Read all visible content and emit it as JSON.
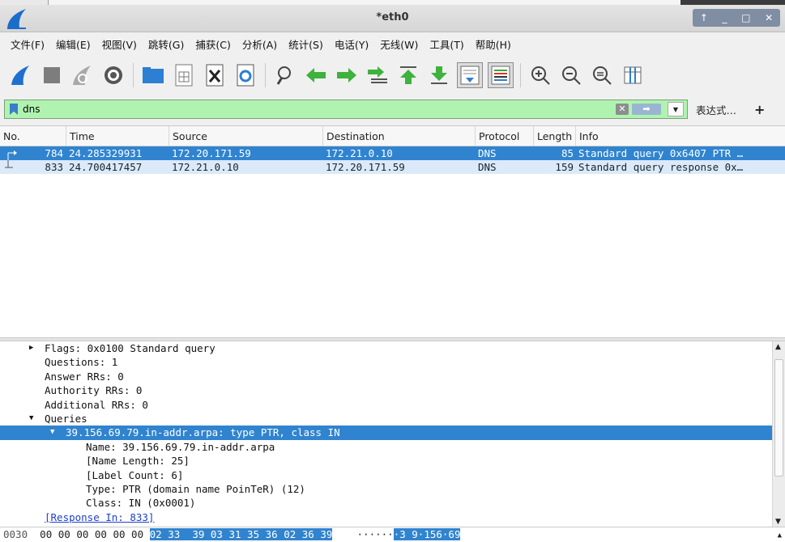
{
  "window": {
    "title": "*eth0",
    "controls": [
      "↑",
      "_",
      "□",
      "✕"
    ]
  },
  "menu": [
    "文件(F)",
    "编辑(E)",
    "视图(V)",
    "跳转(G)",
    "捕获(C)",
    "分析(A)",
    "统计(S)",
    "电话(Y)",
    "无线(W)",
    "工具(T)",
    "帮助(H)"
  ],
  "filter": {
    "value": "dns",
    "expression_label": "表达式…",
    "add_label": "+",
    "bg_color": "#b0f3b0"
  },
  "packet_list": {
    "columns": [
      "No.",
      "Time",
      "Source",
      "Destination",
      "Protocol",
      "Length",
      "Info"
    ],
    "rows": [
      {
        "no": "784",
        "time": "24.285329931",
        "src": "172.20.171.59",
        "dst": "172.21.0.10",
        "proto": "DNS",
        "len": "85",
        "info": "Standard query 0x6407 PTR …"
      },
      {
        "no": "833",
        "time": "24.700417457",
        "src": "172.21.0.10",
        "dst": "172.20.171.59",
        "proto": "DNS",
        "len": "159",
        "info": "Standard query response 0x…"
      }
    ]
  },
  "details": [
    {
      "text": "Flags: 0x0100 Standard query",
      "arrow": "▶"
    },
    {
      "text": "Questions: 1"
    },
    {
      "text": "Answer RRs: 0"
    },
    {
      "text": "Authority RRs: 0"
    },
    {
      "text": "Additional RRs: 0"
    },
    {
      "text": "Queries",
      "arrow": "▼"
    },
    {
      "text": "39.156.69.79.in-addr.arpa: type PTR, class IN",
      "arrow": "▼"
    },
    {
      "text": "Name: 39.156.69.79.in-addr.arpa"
    },
    {
      "text": "[Name Length: 25]"
    },
    {
      "text": "[Label Count: 6]"
    },
    {
      "text": "Type: PTR (domain name PoinTeR) (12)"
    },
    {
      "text": "Class: IN (0x0001)"
    },
    {
      "text": "[Response In: 833]"
    }
  ],
  "hex": {
    "offset": "0030",
    "bytes_plain": "00 00 00 00 00 00",
    "bytes_hl": "02 33  39 03 31 35 36 02 36 39",
    "ascii_plain": "······",
    "ascii_hl": "·3 9·156·69"
  },
  "colors": {
    "selection": "#3084cf",
    "related": "#dce9f8",
    "link": "#1c3fc9"
  }
}
